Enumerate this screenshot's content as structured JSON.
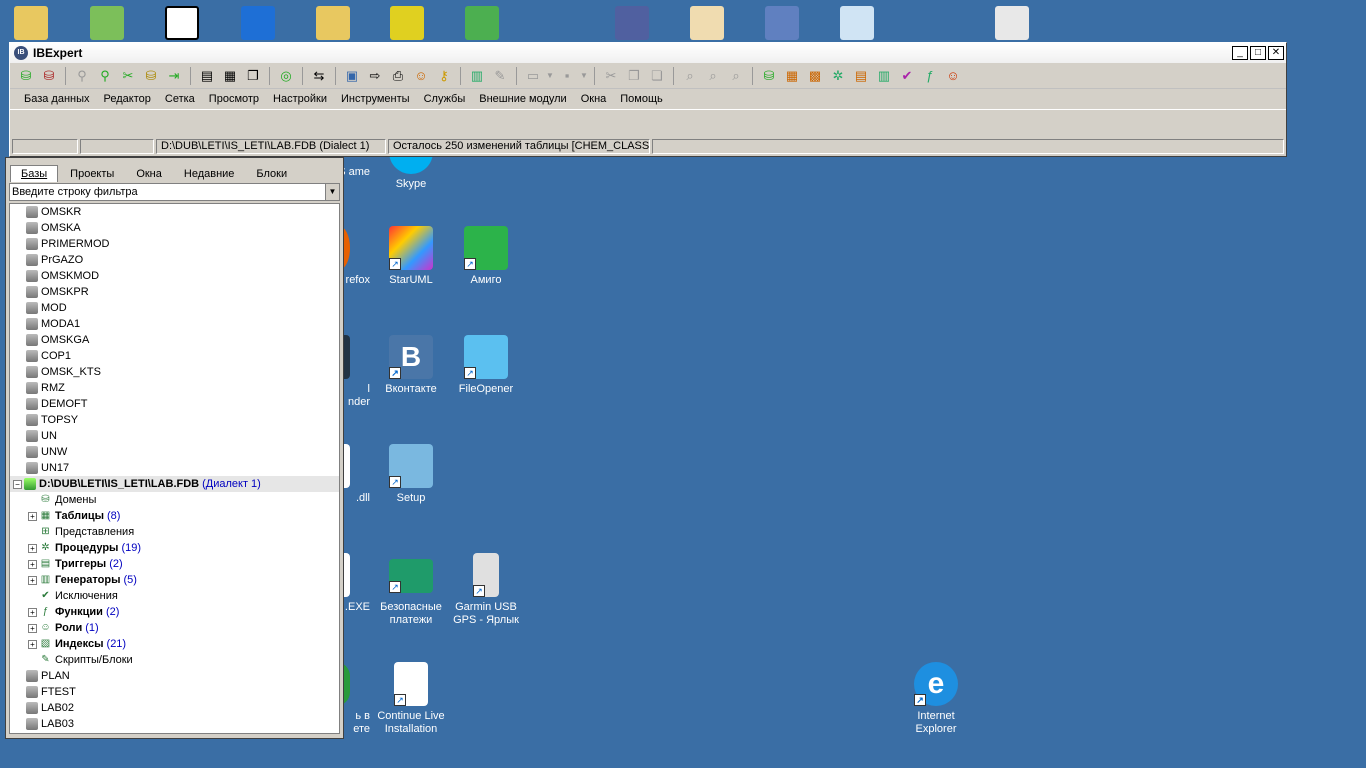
{
  "window": {
    "title": "IBExpert",
    "logo": "IB",
    "controls": [
      "_",
      "□",
      "✕"
    ]
  },
  "menu": [
    "База данных",
    "Редактор",
    "Сетка",
    "Просмотр",
    "Настройки",
    "Инструменты",
    "Службы",
    "Внешние модули",
    "Окна",
    "Помощь"
  ],
  "status": {
    "panel1": "",
    "panel2": "",
    "db_path": "D:\\DUB\\LETI\\IS_LETI\\LAB.FDB (Dialect 1)",
    "message": "Осталось 250 изменений таблицы [CHEM_CLASS]"
  },
  "explorer": {
    "tabs": [
      "Базы",
      "Проекты",
      "Окна",
      "Недавние",
      "Блоки"
    ],
    "active_tab": "Базы",
    "filter_placeholder": "Введите строку фильтра",
    "databases_top": [
      "OMSKR",
      "OMSKA",
      "PRIMERMOD",
      "PrGAZO",
      "OMSKMOD",
      "OMSKPR",
      "MOD",
      "MODA1",
      "OMSKGA",
      "COP1",
      "OMSK_KTS",
      "RMZ",
      "DEMOFT",
      "TOPSY",
      "UN",
      "UNW",
      "UN17"
    ],
    "active_db": {
      "path": "D:\\DUB\\LETI\\IS_LETI\\LAB.FDB",
      "dialect": "(Диалект 1)"
    },
    "objects": [
      {
        "label": "Домены",
        "count": "",
        "bold": false,
        "expandable": false,
        "icon": "domain-icon"
      },
      {
        "label": "Таблицы",
        "count": "(8)",
        "bold": true,
        "expandable": true,
        "icon": "table-icon"
      },
      {
        "label": "Представления",
        "count": "",
        "bold": false,
        "expandable": false,
        "icon": "view-icon"
      },
      {
        "label": "Процедуры",
        "count": "(19)",
        "bold": true,
        "expandable": true,
        "icon": "procedure-icon"
      },
      {
        "label": "Триггеры",
        "count": "(2)",
        "bold": true,
        "expandable": true,
        "icon": "trigger-icon"
      },
      {
        "label": "Генераторы",
        "count": "(5)",
        "bold": true,
        "expandable": true,
        "icon": "generator-icon"
      },
      {
        "label": "Исключения",
        "count": "",
        "bold": false,
        "expandable": false,
        "icon": "exception-icon"
      },
      {
        "label": "Функции",
        "count": "(2)",
        "bold": true,
        "expandable": true,
        "icon": "function-icon"
      },
      {
        "label": "Роли",
        "count": "(1)",
        "bold": true,
        "expandable": true,
        "icon": "role-icon"
      },
      {
        "label": "Индексы",
        "count": "(21)",
        "bold": true,
        "expandable": true,
        "icon": "index-icon"
      },
      {
        "label": "Скрипты/Блоки",
        "count": "",
        "bold": false,
        "expandable": false,
        "icon": "script-icon"
      }
    ],
    "databases_bottom": [
      "PLAN",
      "FTEST",
      "LAB02",
      "LAB03"
    ]
  },
  "desktop": {
    "icons": [
      {
        "label": "S\name",
        "name": "partial-icon-1"
      },
      {
        "label": "Skype",
        "name": "skype-icon"
      },
      {
        "label": "refox",
        "name": "firefox-icon"
      },
      {
        "label": "StarUML",
        "name": "staruml-icon"
      },
      {
        "label": "Амиго",
        "name": "amigo-icon"
      },
      {
        "label": "l\nnder",
        "name": "partial-icon-2"
      },
      {
        "label": "Вконтакте",
        "name": "vk-icon"
      },
      {
        "label": "FileOpener",
        "name": "fileopener-icon"
      },
      {
        "label": ".dll",
        "name": "dll-icon"
      },
      {
        "label": "Setup",
        "name": "setup-icon"
      },
      {
        "label": ".EXE",
        "name": "exe-icon"
      },
      {
        "label": "Безопасные\nплатежи",
        "name": "safe-payments-icon"
      },
      {
        "label": "Garmin USB\nGPS - Ярлык",
        "name": "garmin-icon"
      },
      {
        "label": "ь в\nете",
        "name": "partial-icon-3"
      },
      {
        "label": "Continue Live\nInstallation",
        "name": "continue-install-icon"
      },
      {
        "label": "Internet\nExplorer",
        "name": "ie-icon"
      }
    ]
  },
  "colors": {
    "desktop": "#3a6ea5",
    "window": "#d4d0c8",
    "accent": "#0000c0"
  }
}
